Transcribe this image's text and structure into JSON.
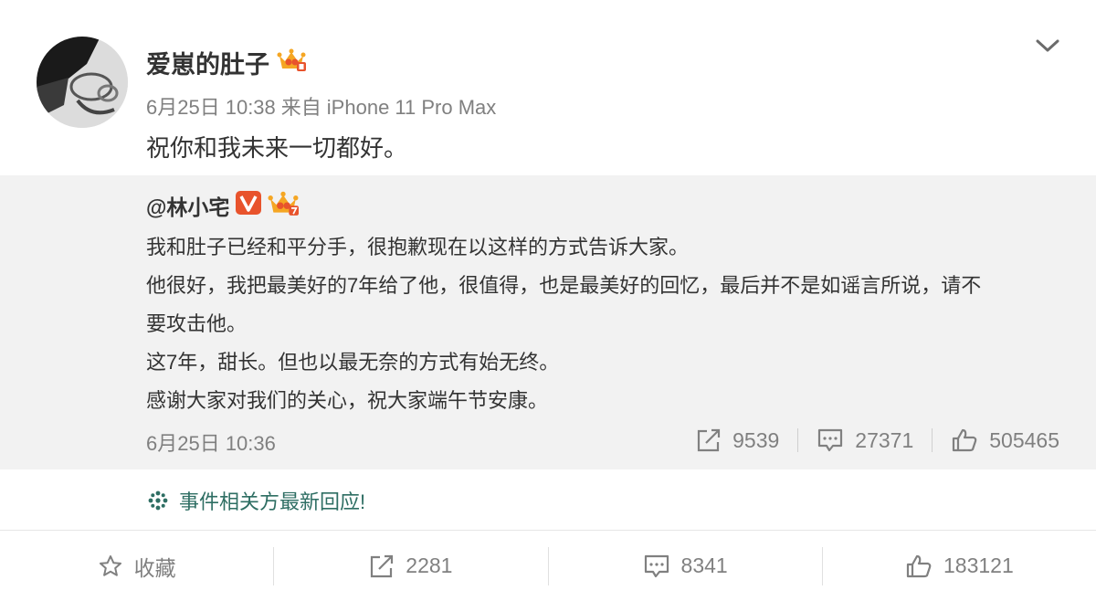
{
  "post": {
    "author": "爱崽的肚子",
    "author_badge_icon": "crown-level-icon",
    "date": "6月25日",
    "time": "10:38",
    "source_prefix": "来自",
    "source_device": "iPhone 11 Pro Max",
    "text": "祝你和我未来一切都好。"
  },
  "repost": {
    "author": "@林小宅",
    "badges": [
      "verified-v-icon",
      "crown-level-icon"
    ],
    "lines": [
      "我和肚子已经和平分手，很抱歉现在以这样的方式告诉大家。",
      "他很好，我把最美好的7年给了他，很值得，也是最美好的回忆，最后并不是如谣言所说，请不",
      "要攻击他。",
      "这7年，甜长。但也以最无奈的方式有始无终。",
      "感谢大家对我们的关心，祝大家端午节安康。"
    ],
    "timestamp": "6月25日 10:36",
    "reposts": "9539",
    "comments": "27371",
    "likes": "505465"
  },
  "event_link": "事件相关方最新回应!",
  "bottom_bar": {
    "favorite_label": "收藏",
    "reposts": "2281",
    "comments": "8341",
    "likes": "183121"
  },
  "colors": {
    "accent_link": "#2e6e63",
    "meta_gray": "#808080",
    "repost_bg": "#f2f2f2",
    "badge_red": "#e8532c",
    "crown_gold": "#f5a623"
  }
}
